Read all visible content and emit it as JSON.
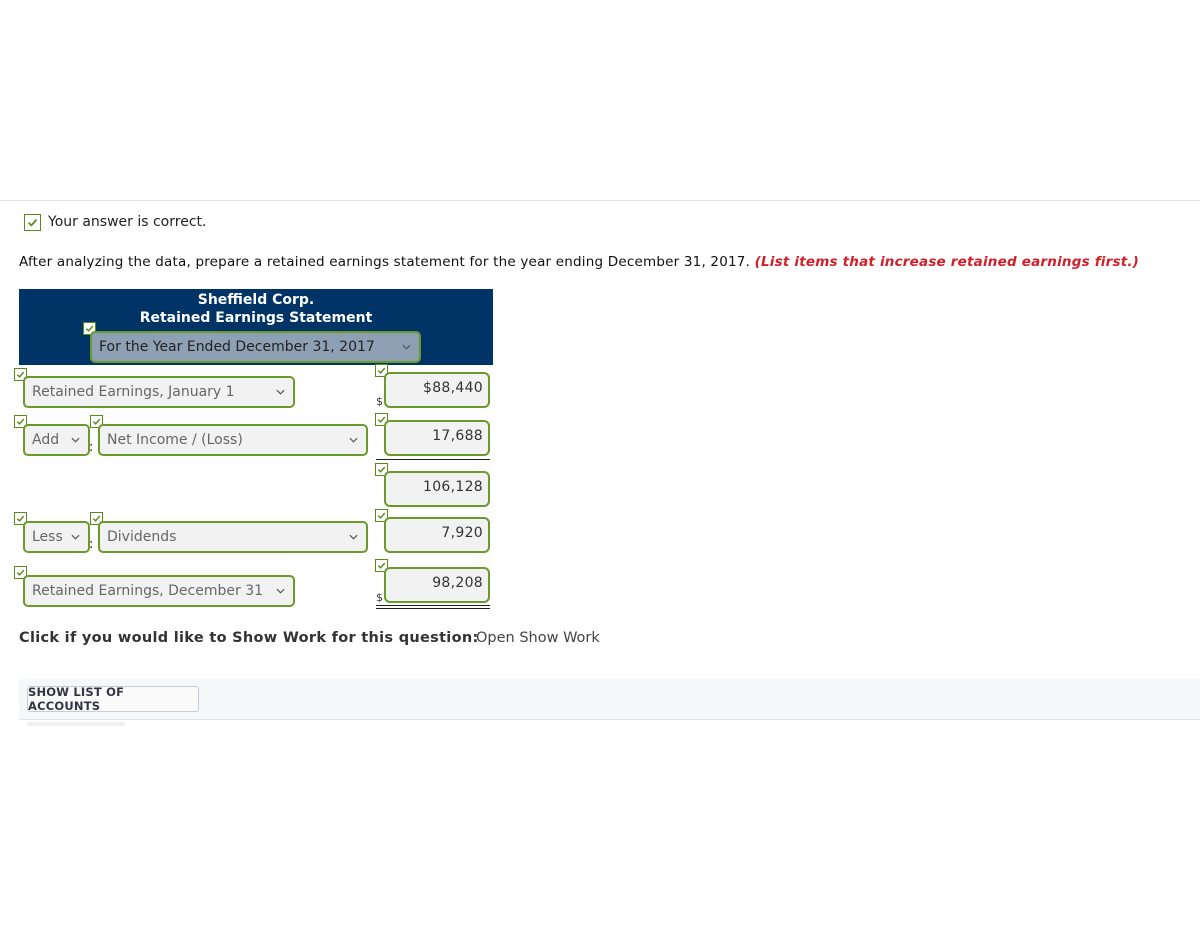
{
  "status": {
    "text": "Your answer is correct."
  },
  "instruction": {
    "text": "After analyzing the data, prepare a retained earnings statement for the year ending December 31, 2017.",
    "highlight": "(List items that increase retained earnings first.)"
  },
  "statement": {
    "company": "Sheffield Corp.",
    "title": "Retained Earnings Statement",
    "period": "For the Year Ended December 31, 2017",
    "rows": [
      {
        "label": "Retained Earnings, January 1",
        "currency": "$",
        "amount": "$88,440"
      },
      {
        "op": "Add",
        "label": "Net Income / (Loss)",
        "amount": "17,688"
      },
      {
        "amount": "106,128"
      },
      {
        "op": "Less",
        "label": "Dividends",
        "amount": "7,920"
      },
      {
        "label": "Retained Earnings, December 31",
        "currency": "$",
        "amount": "98,208"
      }
    ]
  },
  "show_work": {
    "prompt": "Click if you would like to Show Work for this question:",
    "link": "Open Show Work"
  },
  "footer": {
    "button": "SHOW LIST OF ACCOUNTS"
  },
  "colors": {
    "header_bg": "#003366",
    "correct_border": "#6a9a2a",
    "highlight": "#d0202a"
  }
}
